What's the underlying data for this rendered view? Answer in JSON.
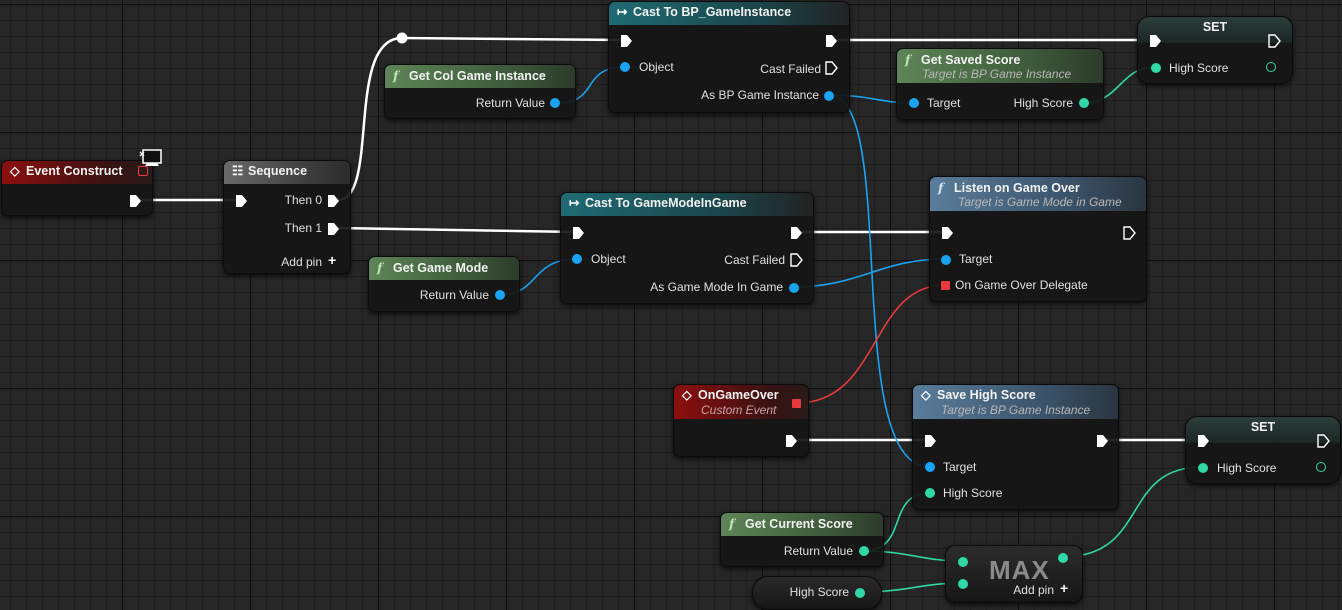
{
  "nodes": {
    "event_construct": {
      "title": "Event Construct"
    },
    "sequence": {
      "title": "Sequence",
      "then0": "Then 0",
      "then1": "Then 1",
      "add_pin": "Add pin"
    },
    "get_col_game_instance": {
      "title": "Get Col Game Instance",
      "return": "Return Value"
    },
    "cast_bp_gameinstance": {
      "title": "Cast To BP_GameInstance",
      "object": "Object",
      "cast_failed": "Cast Failed",
      "as_out": "As BP Game Instance"
    },
    "get_saved_score": {
      "title": "Get Saved Score",
      "subtitle": "Target is BP Game Instance",
      "target": "Target",
      "high_score": "High Score"
    },
    "set_top": {
      "title": "SET",
      "high_score": "High Score"
    },
    "get_game_mode": {
      "title": "Get Game Mode",
      "return": "Return Value"
    },
    "cast_gamemode": {
      "title": "Cast To GameModeInGame",
      "object": "Object",
      "cast_failed": "Cast Failed",
      "as_out": "As Game Mode In Game"
    },
    "listen_game_over": {
      "title": "Listen on Game Over",
      "subtitle": "Target is Game Mode in Game",
      "target": "Target",
      "delegate": "On Game Over Delegate"
    },
    "on_game_over": {
      "title": "OnGameOver",
      "subtitle": "Custom Event"
    },
    "save_high_score": {
      "title": "Save High Score",
      "subtitle": "Target is BP Game Instance",
      "target": "Target",
      "high_score": "High Score"
    },
    "set_bottom": {
      "title": "SET",
      "high_score": "High Score"
    },
    "get_current_score": {
      "title": "Get Current Score",
      "return": "Return Value"
    },
    "high_score_var": {
      "label": "High Score"
    },
    "max": {
      "title": "MAX",
      "add_pin": "Add pin"
    }
  },
  "colors": {
    "exec": "#ffffff",
    "object": "#1aa3f0",
    "float": "#2fd8a6",
    "delegate": "#e83b3b"
  },
  "icons": {
    "event": "diamond-event-icon",
    "function": "function-f-icon",
    "sequence": "sequence-icon",
    "cast": "cast-arrow-icon",
    "client": "monitor-client-icon"
  }
}
